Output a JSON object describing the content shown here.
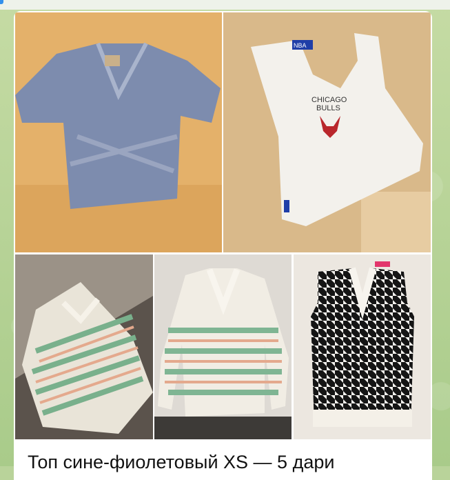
{
  "album": {
    "photos": [
      {
        "alt": "blue-violet-crop-top-photo"
      },
      {
        "alt": "chicago-bulls-white-tank-top-photo"
      },
      {
        "alt": "patterned-sweater-on-floor-photo"
      },
      {
        "alt": "patterned-sweater-on-bed-photo"
      },
      {
        "alt": "houndstooth-knit-vest-photo"
      }
    ]
  },
  "tank_top": {
    "print_line1": "CHICAGO",
    "print_line2": "BULLS",
    "tag": "NBA"
  },
  "message": {
    "caption": "Топ сине-фиолетовый XS — 5 дари"
  },
  "colors": {
    "chat_background": "#b9d39a",
    "bubble": "#ffffff",
    "accent": "#3390ec"
  }
}
